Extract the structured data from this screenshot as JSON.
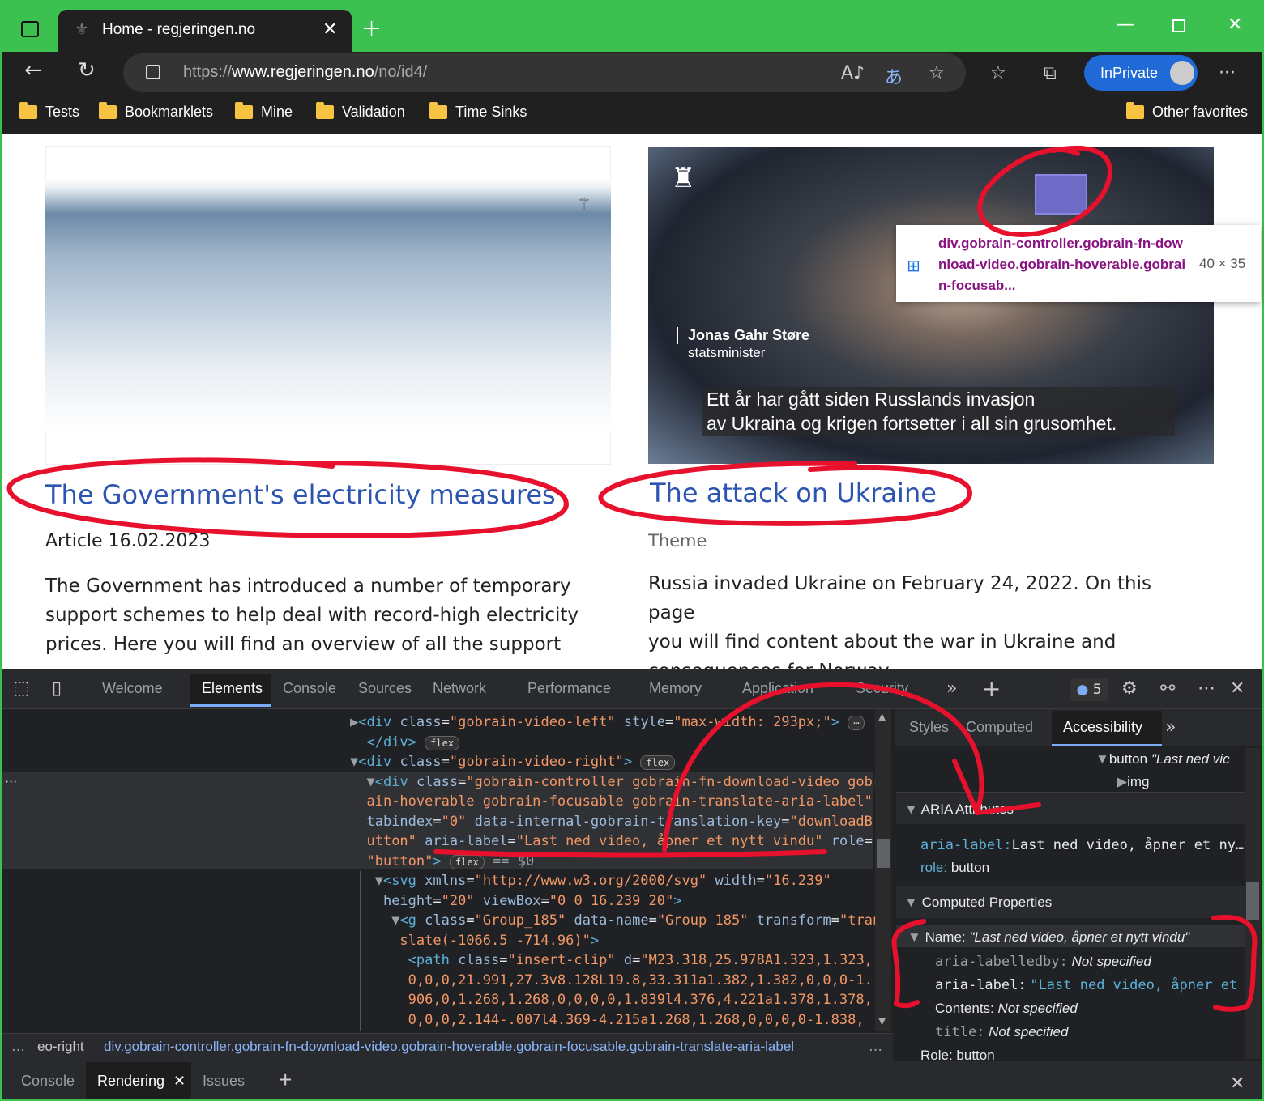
{
  "browser": {
    "tab_title": "Home - regjeringen.no",
    "url_prefix": "https://",
    "url_host": "www.regjeringen.no",
    "url_path": "/no/id4/",
    "inprivate_label": "InPrivate",
    "favorites": [
      "Tests",
      "Bookmarklets",
      "Mine",
      "Validation",
      "Time Sinks"
    ],
    "other_favorites": "Other favorites"
  },
  "page": {
    "left_card": {
      "title": "The Government's electricity measures",
      "meta": "Article 16.02.2023",
      "body": [
        "The Government has introduced a number of temporary",
        "support schemes to help deal with record-high electricity",
        "prices. Here you will find an overview of all the support"
      ]
    },
    "right_card": {
      "title": "The attack on Ukraine",
      "meta": "Theme",
      "body": [
        "Russia invaded Ukraine on February 24, 2022. On this page",
        "you will find content about the war in Ukraine and",
        "consequences for Norway."
      ],
      "video": {
        "speaker_name": "Jonas Gahr Støre",
        "speaker_title": "statsminister",
        "subtitle_line1": "Ett år har gått siden Russlands invasjon",
        "subtitle_line2": "av Ukraina og krigen fortsetter i all sin grusomhet."
      }
    },
    "inspect_tooltip": {
      "selector": "div.gobrain-controller.gobrain-fn-download-video.gobrain-hoverable.gobrain-focusab...",
      "size": "40 × 35"
    }
  },
  "devtools": {
    "tabs": [
      "Welcome",
      "Elements",
      "Console",
      "Sources",
      "Network",
      "Performance",
      "Memory",
      "Application",
      "Security"
    ],
    "issues_count": "5",
    "side_tabs": [
      "Styles",
      "Computed",
      "Accessibility"
    ],
    "tree": {
      "button_node": "button",
      "button_name": "\"Last ned vic",
      "img_node": "img"
    },
    "aria_attributes": {
      "header": "ARIA Attributes",
      "aria_label_key": "aria-label:",
      "aria_label_val": "Last ned video, åpner et ny…",
      "role_key": "role:",
      "role_val": "button"
    },
    "computed": {
      "header": "Computed Properties",
      "name_key": "Name:",
      "name_val": "\"Last ned video, åpner et nytt vindu\"",
      "labelledby_key": "aria-labelledby:",
      "labelledby_val": "Not specified",
      "arialabel_key": "aria-label:",
      "arialabel_val": "\"Last ned video, åpner et …",
      "contents_key": "Contents:",
      "contents_val": "Not specified",
      "title_key": "title:",
      "title_val": "Not specified",
      "role_line": "Role: button"
    },
    "breadcrumb": {
      "left": "eo-right",
      "selector": "div.gobrain-controller.gobrain-fn-download-video.gobrain-hoverable.gobrain-focusable.gobrain-translate-aria-label"
    },
    "drawer_tabs": [
      "Console",
      "Rendering",
      "Issues"
    ],
    "badge_flex": "flex"
  }
}
